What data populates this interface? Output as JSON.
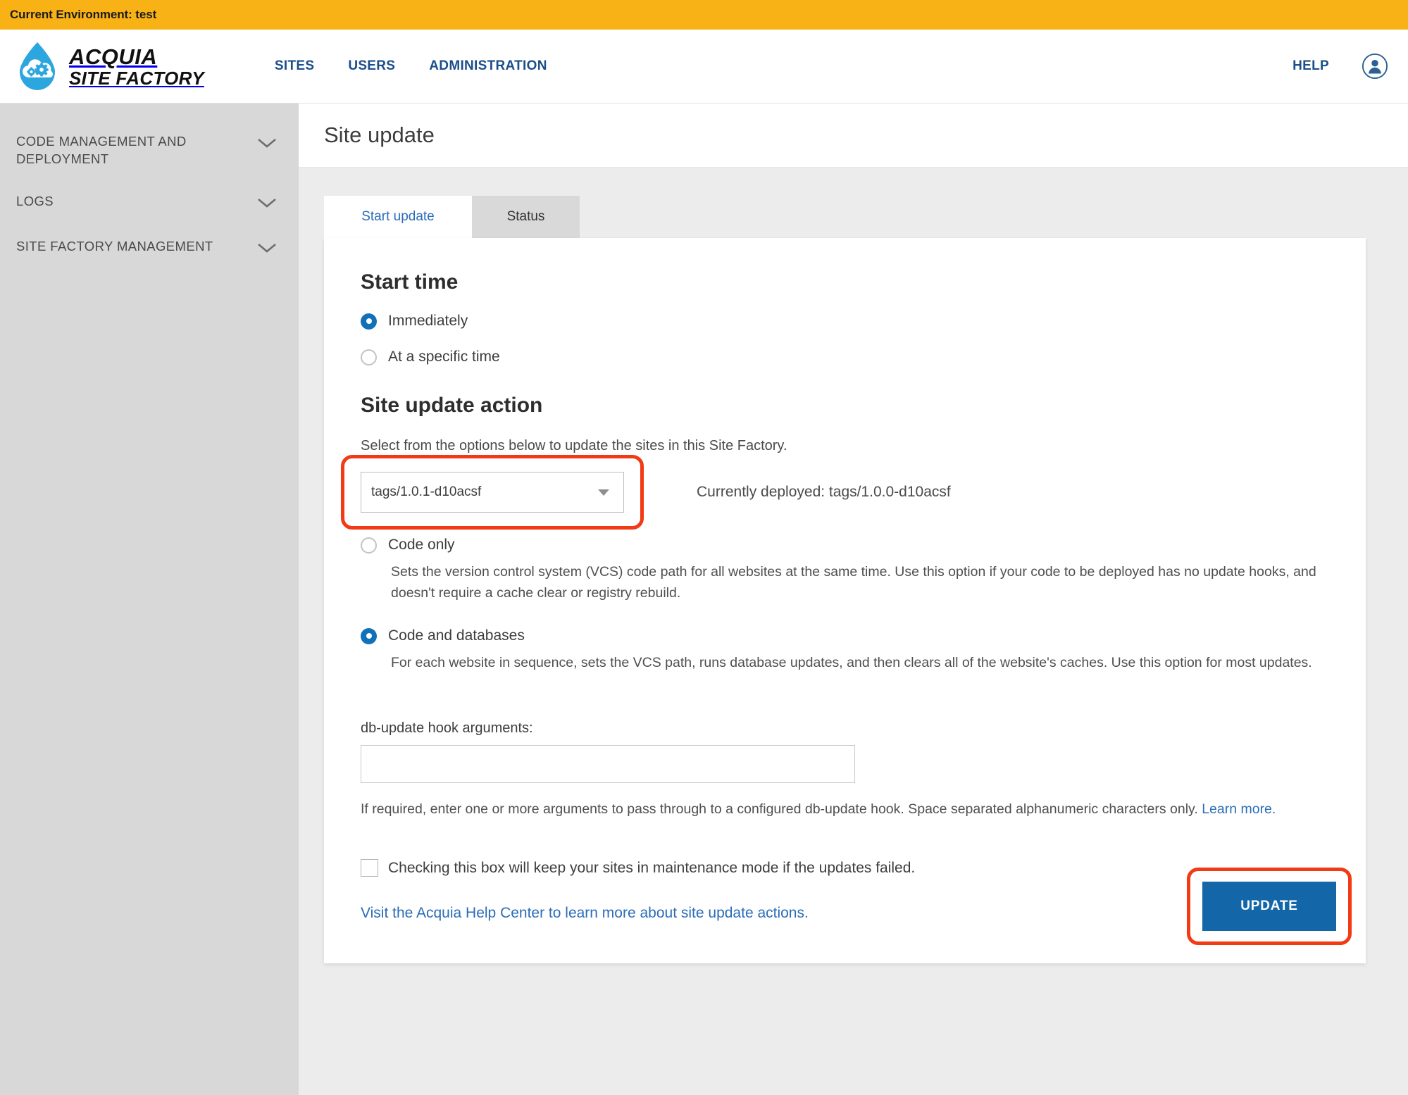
{
  "env_banner": {
    "text": "Current Environment: test"
  },
  "brand": {
    "line1": "ACQUIA",
    "line2": "SITE FACTORY",
    "logo_icon": "acquia-droplet-cloud-gear-logo"
  },
  "nav": {
    "items": [
      {
        "label": "SITES"
      },
      {
        "label": "USERS"
      },
      {
        "label": "ADMINISTRATION"
      }
    ],
    "help_label": "HELP",
    "avatar_icon": "user-circle-icon"
  },
  "sidebar": {
    "items": [
      {
        "label": "CODE MANAGEMENT AND DEPLOYMENT",
        "icon": "chevron-down-icon"
      },
      {
        "label": "LOGS",
        "icon": "chevron-down-icon"
      },
      {
        "label": "SITE FACTORY MANAGEMENT",
        "icon": "chevron-down-icon"
      }
    ]
  },
  "page": {
    "title": "Site update"
  },
  "tabs": [
    {
      "label": "Start update",
      "active": true
    },
    {
      "label": "Status",
      "active": false
    }
  ],
  "start_time": {
    "heading": "Start time",
    "options": [
      {
        "label": "Immediately",
        "selected": true
      },
      {
        "label": "At a specific time",
        "selected": false
      }
    ]
  },
  "site_update_action": {
    "heading": "Site update action",
    "intro": "Select from the options below to update the sites in this Site Factory.",
    "select_value": "tags/1.0.1-d10acsf",
    "currently_deployed": "Currently deployed: tags/1.0.0-d10acsf",
    "options": [
      {
        "label": "Code only",
        "selected": false,
        "description": "Sets the version control system (VCS) code path for all websites at the same time. Use this option if your code to be deployed has no update hooks, and doesn't require a cache clear or registry rebuild."
      },
      {
        "label": "Code and databases",
        "selected": true,
        "description": "For each website in sequence, sets the VCS path, runs database updates, and then clears all of the website's caches. Use this option for most updates."
      }
    ]
  },
  "db_hook": {
    "label": "db-update hook arguments:",
    "value": "",
    "placeholder": "",
    "helper_text": "If required, enter one or more arguments to pass through to a configured db-update hook. Space separated alphanumeric characters only. ",
    "helper_link": "Learn more."
  },
  "maintenance": {
    "label": "Checking this box will keep your sites in maintenance mode if the updates failed.",
    "checked": false
  },
  "help_center_link": "Visit the Acquia Help Center to learn more about site update actions.",
  "update_button": {
    "label": "UPDATE"
  },
  "colors": {
    "banner": "#f9b215",
    "nav_blue": "#1c4e8a",
    "link_blue": "#2b6cb8",
    "radio_blue": "#1071b8",
    "button_blue": "#1367a8",
    "annotation_red": "#f23a15",
    "sidebar_gray": "#d8d8d8",
    "content_gray": "#ececec",
    "logo_blue": "#2ba6de"
  }
}
